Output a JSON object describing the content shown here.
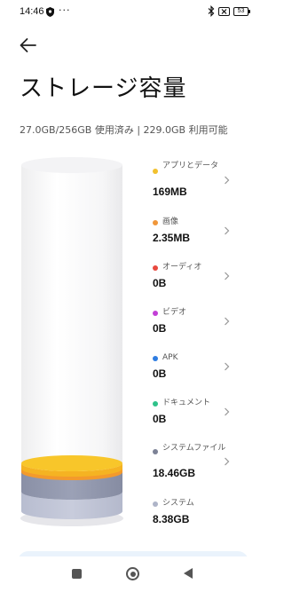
{
  "status_bar": {
    "time": "14:46",
    "more": "···",
    "battery": "53"
  },
  "header": {
    "title": "ストレージ容量",
    "summary": "27.0GB/256GB 使用済み | 229.0GB 利用可能"
  },
  "legend": [
    {
      "label": "アプリとデータ",
      "value": "169MB",
      "color": "#f2c12e",
      "icon": "yellow-dot"
    },
    {
      "label": "画像",
      "value": "2.35MB",
      "color": "#f0973a",
      "icon": "orange-dot"
    },
    {
      "label": "オーディオ",
      "value": "0B",
      "color": "#e8493f",
      "icon": "red-dot"
    },
    {
      "label": "ビデオ",
      "value": "0B",
      "color": "#c23fd6",
      "icon": "purple-dot"
    },
    {
      "label": "APK",
      "value": "0B",
      "color": "#2f7de1",
      "icon": "blue-dot"
    },
    {
      "label": "ドキュメント",
      "value": "0B",
      "color": "#2fc28a",
      "icon": "green-dot"
    },
    {
      "label": "システムファイル",
      "value": "18.46GB",
      "color": "#7c8296",
      "icon": "gray-dot"
    },
    {
      "label": "システム",
      "value": "8.38GB",
      "color": "#aeb4c8",
      "icon": "light-gray-dot"
    }
  ],
  "nav": {
    "recent": "recent-apps-icon",
    "home": "home-icon",
    "back": "back-icon"
  }
}
